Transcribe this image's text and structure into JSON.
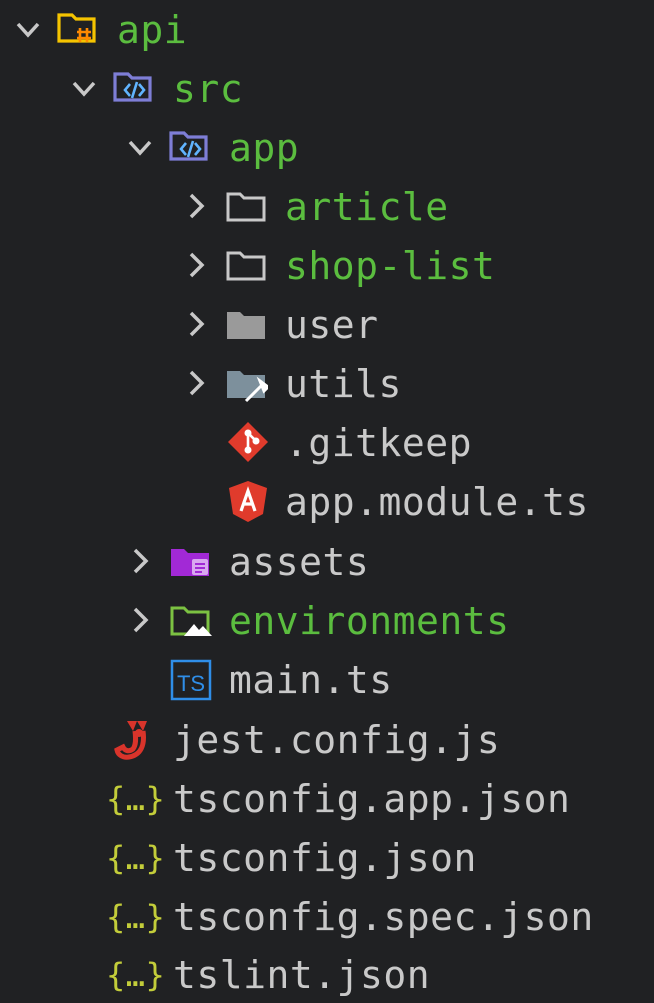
{
  "explorer": {
    "items": [
      {
        "label": "api",
        "icon": "folder-api-open-icon",
        "expanded": true,
        "color": "#5bbd3f"
      },
      {
        "label": "src",
        "icon": "folder-src-open-icon",
        "expanded": true,
        "color": "#5bbd3f"
      },
      {
        "label": "app",
        "icon": "folder-app-open-icon",
        "expanded": true,
        "color": "#5bbd3f"
      },
      {
        "label": "article",
        "icon": "folder-outline-icon",
        "expanded": false,
        "color": "#5bbd3f"
      },
      {
        "label": "shop-list",
        "icon": "folder-outline-icon",
        "expanded": false,
        "color": "#5bbd3f"
      },
      {
        "label": "user",
        "icon": "folder-grey-icon",
        "expanded": false,
        "color": "#c9c9c9"
      },
      {
        "label": "utils",
        "icon": "folder-utils-icon",
        "expanded": false,
        "color": "#c9c9c9"
      },
      {
        "label": ".gitkeep",
        "icon": "git-icon",
        "color": "#c9c9c9"
      },
      {
        "label": "app.module.ts",
        "icon": "angular-icon",
        "color": "#c9c9c9"
      },
      {
        "label": "assets",
        "icon": "folder-assets-icon",
        "expanded": false,
        "color": "#c9c9c9"
      },
      {
        "label": "environments",
        "icon": "folder-environment-icon",
        "expanded": false,
        "color": "#5bbd3f"
      },
      {
        "label": "main.ts",
        "icon": "typescript-icon",
        "color": "#c9c9c9"
      },
      {
        "label": "jest.config.js",
        "icon": "jest-icon",
        "color": "#c9c9c9"
      },
      {
        "label": "tsconfig.app.json",
        "icon": "json-icon",
        "color": "#c9c9c9"
      },
      {
        "label": "tsconfig.json",
        "icon": "json-icon",
        "color": "#c9c9c9"
      },
      {
        "label": "tsconfig.spec.json",
        "icon": "json-icon",
        "color": "#c9c9c9"
      },
      {
        "label": "tslint.json",
        "icon": "json-icon",
        "color": "#c9c9c9"
      }
    ],
    "colors": {
      "background": "#202123",
      "modified": "#5bbd3f",
      "default": "#c9c9c9"
    }
  }
}
